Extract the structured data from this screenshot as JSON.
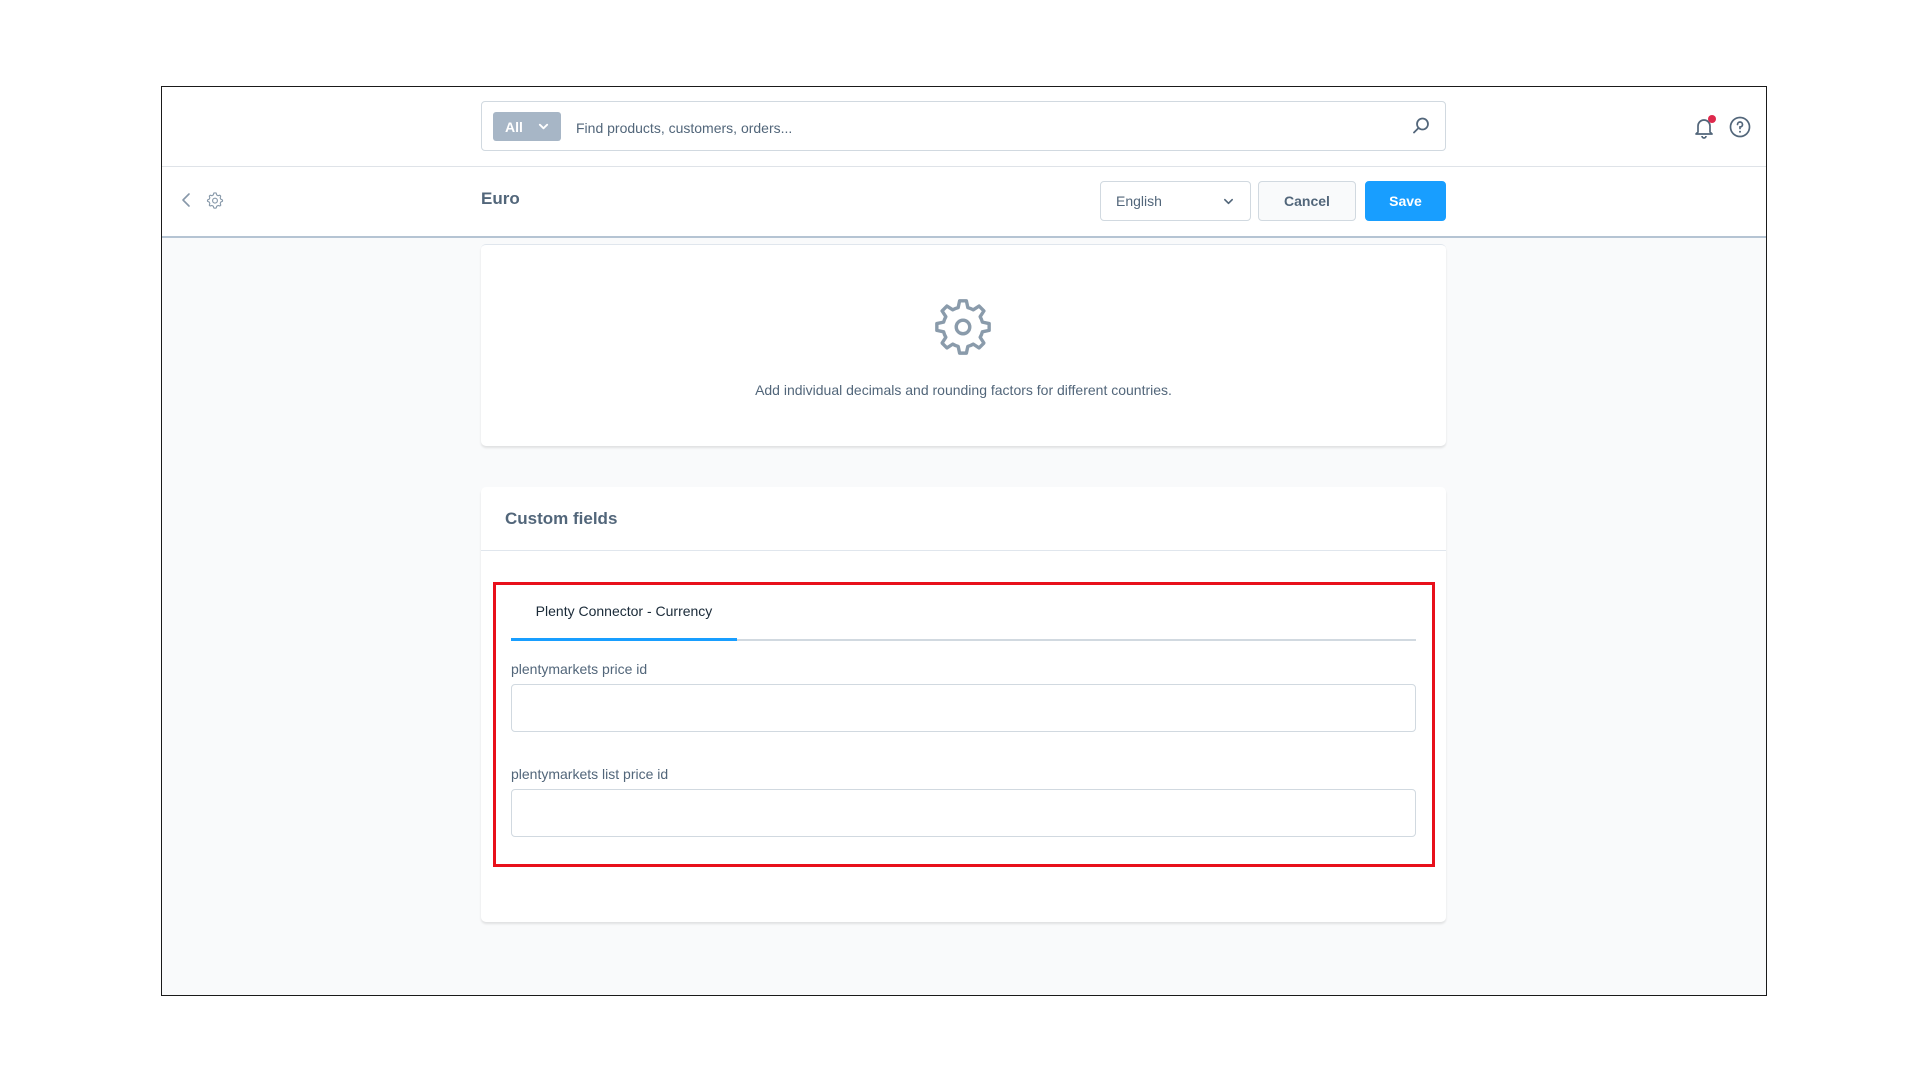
{
  "search": {
    "type_label": "All",
    "placeholder": "Find products, customers, orders..."
  },
  "header": {
    "title": "Euro",
    "language": "English",
    "cancel_label": "Cancel",
    "save_label": "Save"
  },
  "empty_state": {
    "text": "Add individual decimals and rounding factors for different countries."
  },
  "custom_fields": {
    "title": "Custom fields",
    "tabs": [
      {
        "label": "Plenty Connector - Currency",
        "active": true
      }
    ],
    "fields": [
      {
        "label": "plentymarkets price id",
        "value": ""
      },
      {
        "label": "plentymarkets list price id",
        "value": ""
      }
    ]
  },
  "colors": {
    "accent": "#189eff",
    "highlight": "#e8101b",
    "notification_dot": "#de294c",
    "text": "#52667a"
  },
  "icons": {
    "search": "search-icon",
    "bell": "bell-icon",
    "help": "help-icon",
    "back": "chevron-left-icon",
    "settings": "gear-icon"
  }
}
